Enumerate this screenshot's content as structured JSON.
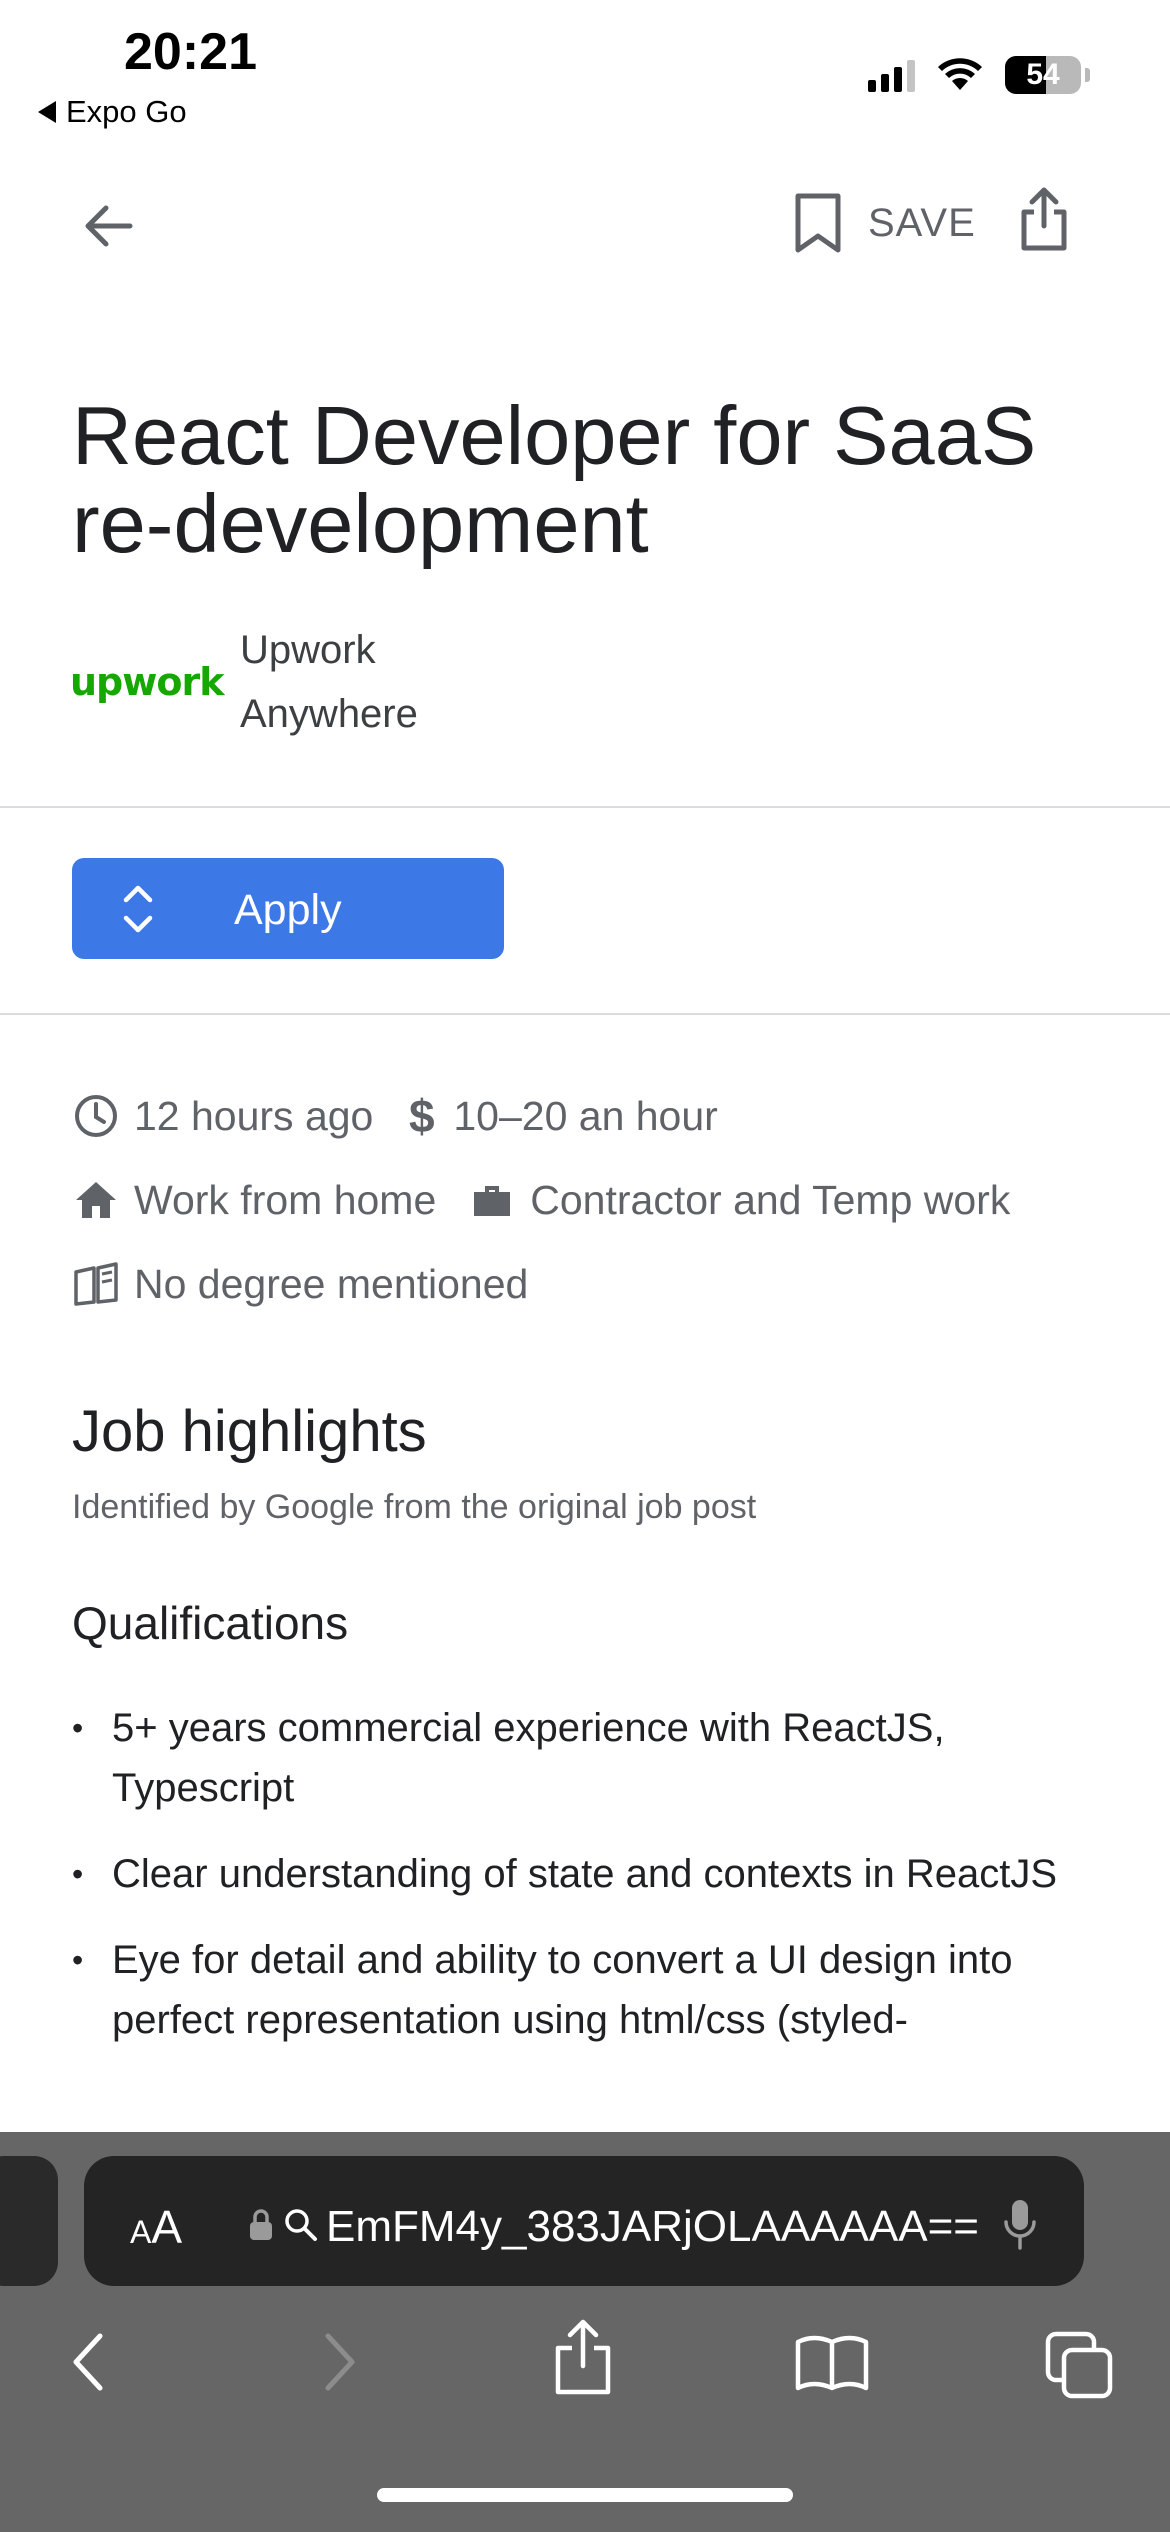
{
  "status_bar": {
    "time": "20:21",
    "back_app": "Expo Go",
    "battery": "54"
  },
  "toolbar": {
    "save_label": "SAVE",
    "icons": [
      "back-arrow-icon",
      "bookmark-icon",
      "share-icon"
    ]
  },
  "job": {
    "title": "React Developer for SaaS re-development",
    "logo_text": "upwork",
    "company": "Upwork",
    "location": "Anywhere"
  },
  "apply": {
    "label": "Apply"
  },
  "meta": {
    "posted": "12 hours ago",
    "pay": "10–20 an hour",
    "work_setting": "Work from home",
    "job_type": "Contractor and Temp work",
    "education": "No degree mentioned"
  },
  "highlights": {
    "title": "Job highlights",
    "subtitle": "Identified by Google from the original job post",
    "qualifications_title": "Qualifications",
    "qualifications": [
      "5+ years commercial experience with ReactJS, Typescript",
      "Clear understanding of state and contexts in ReactJS",
      "Eye for detail and ability to convert a UI design into perfect representation using html/css (styled-"
    ]
  },
  "browser": {
    "text_size_label_small": "A",
    "text_size_label_large": "A",
    "url": "EmFM4y_383JARjOLAAAAAA=="
  },
  "colors": {
    "accent": "#3c78e6",
    "upwork_green": "#14a800",
    "browser_bar": "#666666"
  }
}
